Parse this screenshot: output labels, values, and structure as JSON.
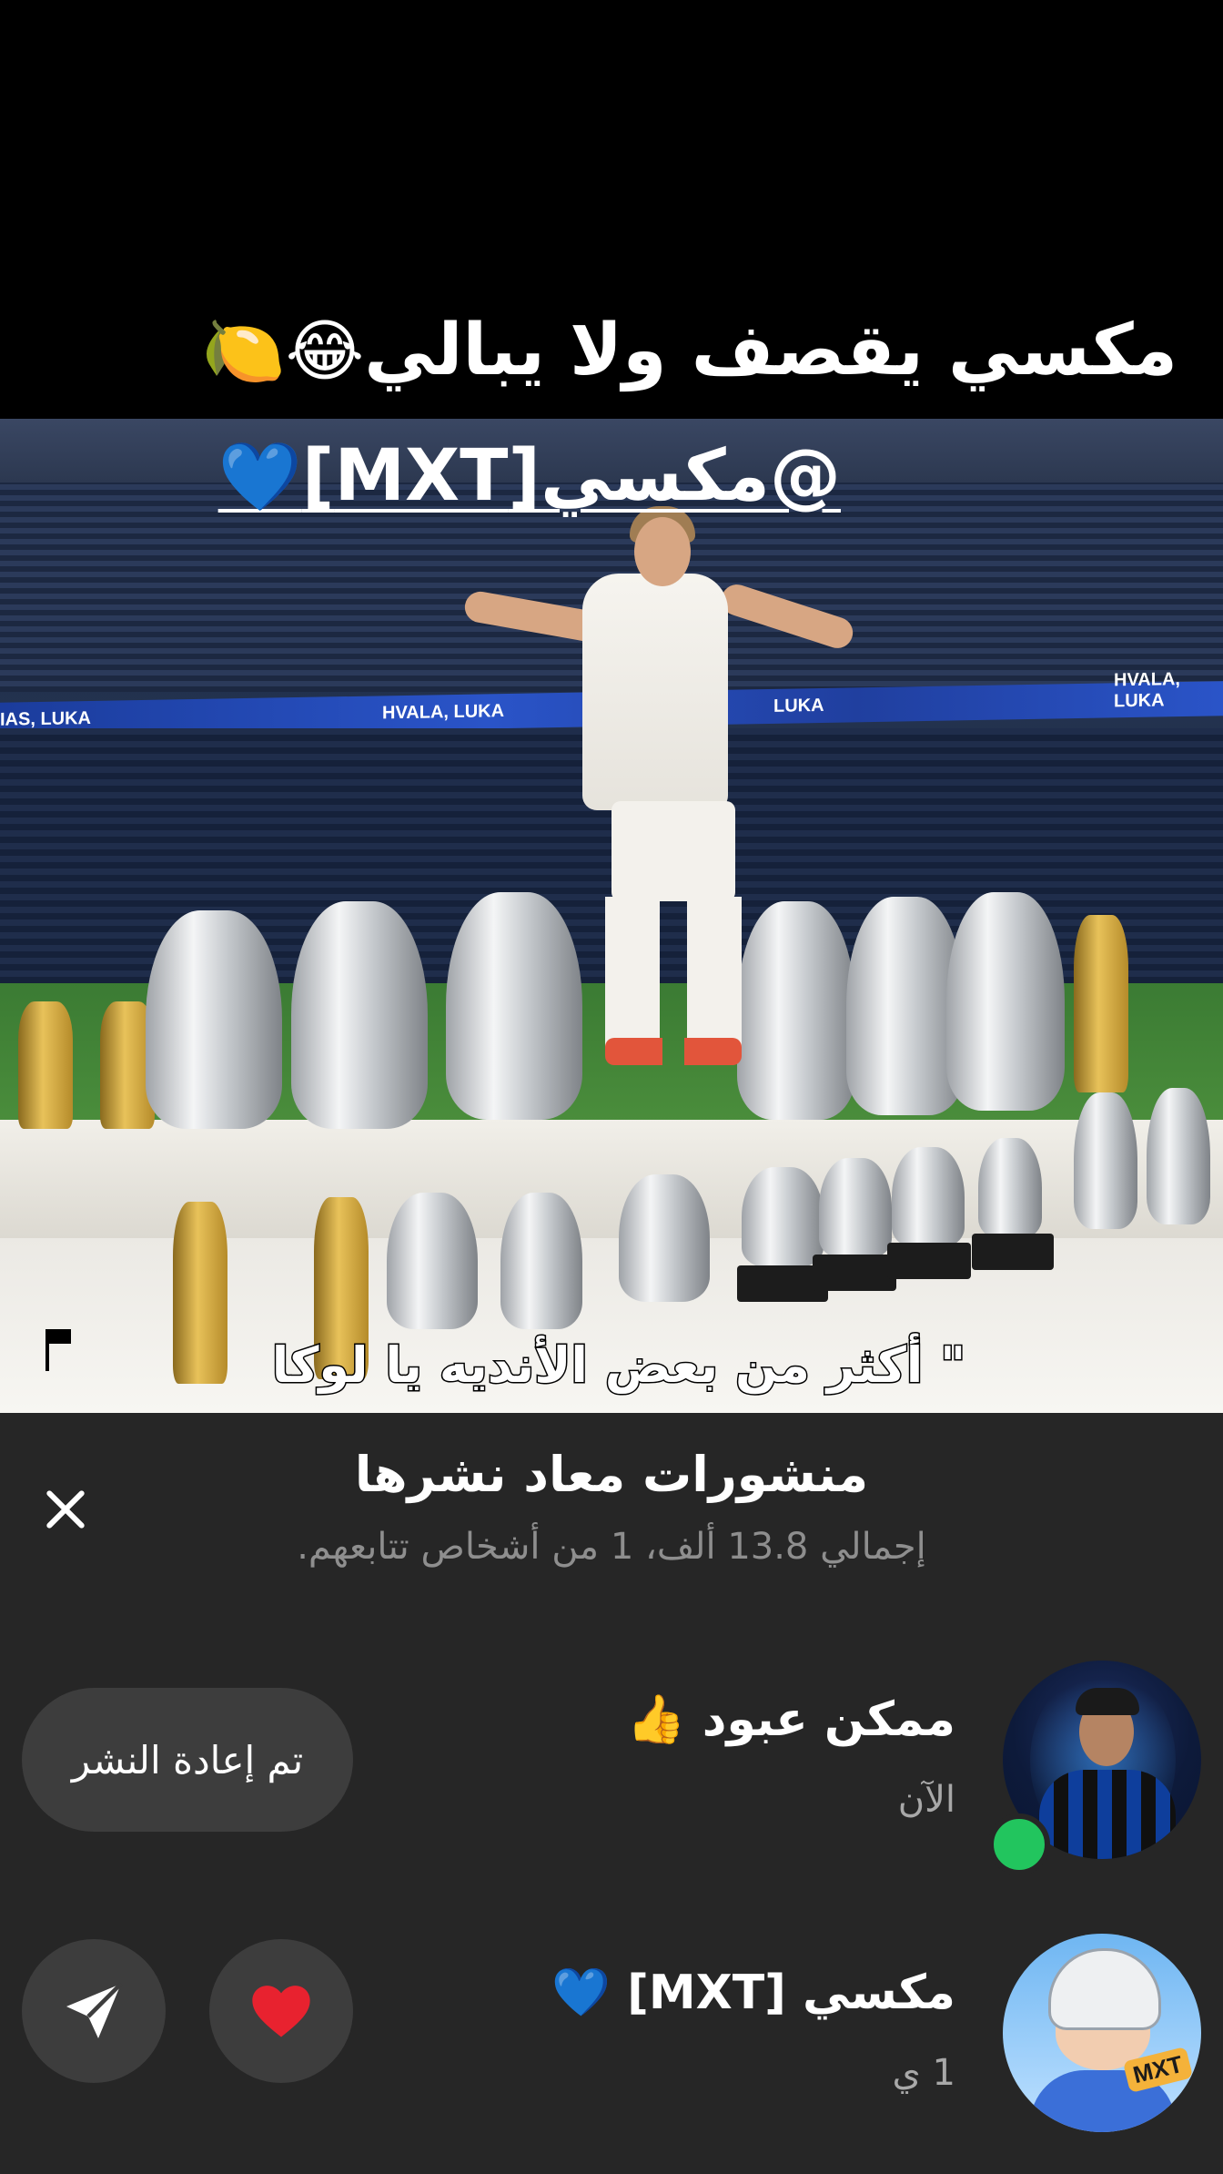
{
  "video": {
    "caption_line1": "مكسي يقصف ولا يبالي",
    "caption_line1_emojis": "😂🍋",
    "caption_line2": "@مكسي[MXT]",
    "caption_line2_emoji": "💙",
    "burned_subtitle": "\" أكثر من بعض الأنديه يا لوكا",
    "led_board_left": "IAS, LUKA",
    "led_board_mid": "HVALA, LUKA",
    "led_board_right_1": "LUKA",
    "led_board_right_2": "HVALA, LUKA"
  },
  "sheet": {
    "title": "منشورات معاد نشرها",
    "subtitle": "إجمالي 13.8 ألف، 1 من أشخاص تتابعهم.",
    "rows": [
      {
        "name": "ممكن عبود 👍",
        "time": "الآن",
        "action_label": "تم إعادة النشر",
        "online": true
      },
      {
        "name": "مكسي [MXT] 💙",
        "time": "1 ي",
        "avatar_tag": "MXT"
      }
    ]
  },
  "colors": {
    "sheet_bg": "#262626",
    "button_bg": "#3d3d3d",
    "online": "#22c55e",
    "heart": "#e8222f"
  },
  "icons": {
    "close": "close-icon",
    "send": "send-icon",
    "heart": "heart-icon"
  }
}
